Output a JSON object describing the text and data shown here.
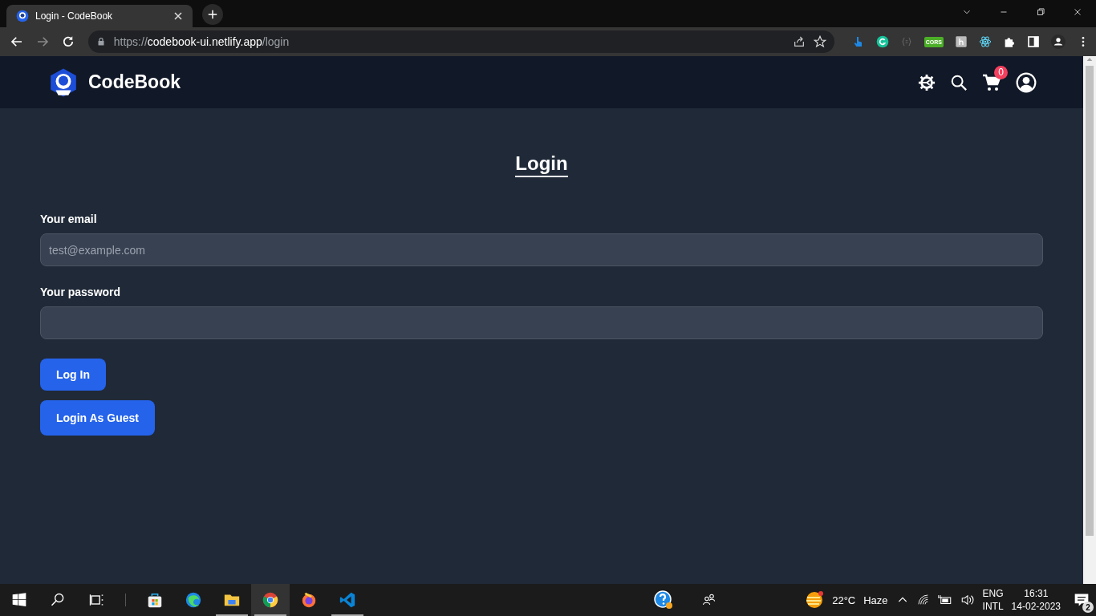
{
  "browser": {
    "tab": {
      "title": "Login - CodeBook",
      "selected": true
    },
    "address": {
      "scheme": "https://",
      "host": "codebook-ui.netlify.app",
      "path": "/login"
    },
    "cors_extension_label": "CORS"
  },
  "header": {
    "brand": "CodeBook",
    "cart_count": "0"
  },
  "login": {
    "title": "Login",
    "fields": [
      {
        "label": "Your email",
        "placeholder": "test@example.com"
      },
      {
        "label": "Your password"
      }
    ],
    "buttons": [
      "Log In",
      "Login As Guest"
    ]
  },
  "taskbar": {
    "apps": [
      {
        "kind": "store",
        "running": false,
        "active": false
      },
      {
        "kind": "edge",
        "running": false,
        "active": false
      },
      {
        "kind": "explorer",
        "running": true,
        "active": false
      },
      {
        "kind": "chrome",
        "running": true,
        "active": true
      },
      {
        "kind": "firefox",
        "running": false,
        "active": false
      },
      {
        "kind": "vscode",
        "running": true,
        "active": false
      }
    ],
    "weather": {
      "temperature": "22°C",
      "condition": "Haze"
    },
    "language": [
      "ENG",
      "INTL"
    ],
    "time": "16:31",
    "date": "14-02-2023",
    "notifications": "2"
  }
}
